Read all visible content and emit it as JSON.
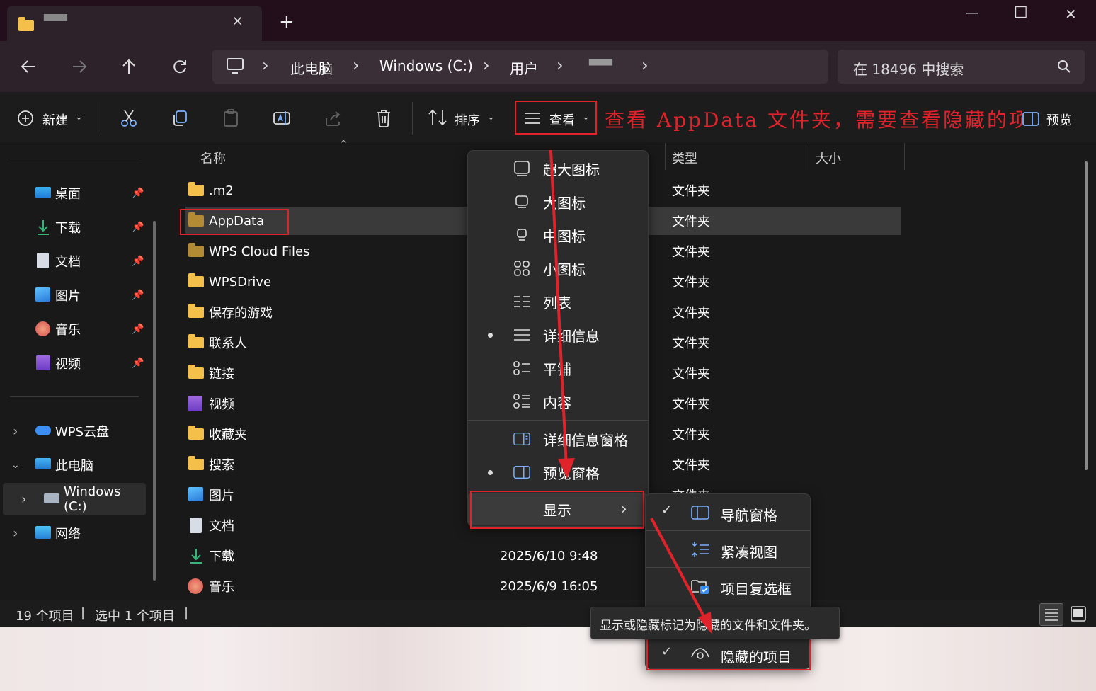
{
  "titlebar": {
    "tab_title": "▀▀▀",
    "close_tab": "✕",
    "new_tab": "+",
    "min": "—",
    "max": "☐",
    "close": "✕"
  },
  "breadcrumb": {
    "items": [
      "此电脑",
      "Windows (C:)",
      "用户",
      "▀▀▀"
    ],
    "chev": "›"
  },
  "search": {
    "placeholder": "在 18496 中搜索"
  },
  "toolbar": {
    "new_label": "新建",
    "sort_label": "排序",
    "view_label": "查看",
    "preview_label": "预览"
  },
  "annotation": {
    "text": "查看 AppData 文件夹，需要查看隐藏的项目"
  },
  "sidebar": {
    "quick": [
      {
        "label": "桌面",
        "icon": "desktop-icon"
      },
      {
        "label": "下载",
        "icon": "download-icon"
      },
      {
        "label": "文档",
        "icon": "document-icon"
      },
      {
        "label": "图片",
        "icon": "picture-icon"
      },
      {
        "label": "音乐",
        "icon": "music-icon"
      },
      {
        "label": "视频",
        "icon": "video-icon"
      }
    ],
    "tree": [
      {
        "label": "WPS云盘",
        "icon": "cloud-icon"
      },
      {
        "label": "此电脑",
        "icon": "computer-icon"
      },
      {
        "label": "Windows (C:)",
        "icon": "drive-icon"
      },
      {
        "label": "网络",
        "icon": "network-icon"
      }
    ]
  },
  "columns": {
    "name": "名称",
    "type": "类型",
    "size": "大小"
  },
  "files": [
    {
      "name": ".m2",
      "type": "文件夹",
      "date": ""
    },
    {
      "name": "AppData",
      "type": "文件夹",
      "date": ""
    },
    {
      "name": "WPS Cloud Files",
      "type": "文件夹",
      "date": ""
    },
    {
      "name": "WPSDrive",
      "type": "文件夹",
      "date": ""
    },
    {
      "name": "保存的游戏",
      "type": "文件夹",
      "date": ""
    },
    {
      "name": "联系人",
      "type": "文件夹",
      "date": ""
    },
    {
      "name": "链接",
      "type": "文件夹",
      "date": ""
    },
    {
      "name": "视频",
      "type": "文件夹",
      "date": ""
    },
    {
      "name": "收藏夹",
      "type": "文件夹",
      "date": ""
    },
    {
      "name": "搜索",
      "type": "文件夹",
      "date": ""
    },
    {
      "name": "图片",
      "type": "文件夹",
      "date": ""
    },
    {
      "name": "文档",
      "type": "",
      "date": ""
    },
    {
      "name": "下载",
      "type": "",
      "date": "2025/6/10 9:48"
    },
    {
      "name": "音乐",
      "type": "",
      "date": "2025/6/9 16:05"
    }
  ],
  "view_menu": {
    "items": [
      {
        "label": "超大图标",
        "icon": "extra-large-icons-icon",
        "selected": false
      },
      {
        "label": "大图标",
        "icon": "large-icons-icon",
        "selected": false
      },
      {
        "label": "中图标",
        "icon": "medium-icons-icon",
        "selected": false
      },
      {
        "label": "小图标",
        "icon": "small-icons-icon",
        "selected": false
      },
      {
        "label": "列表",
        "icon": "list-icon",
        "selected": false
      },
      {
        "label": "详细信息",
        "icon": "details-icon",
        "selected": true
      },
      {
        "label": "平铺",
        "icon": "tiles-icon",
        "selected": false
      },
      {
        "label": "内容",
        "icon": "content-icon",
        "selected": false
      }
    ],
    "panes": [
      {
        "label": "详细信息窗格",
        "icon": "details-pane-icon",
        "selected": false
      },
      {
        "label": "预览窗格",
        "icon": "preview-pane-icon",
        "selected": true
      }
    ],
    "show_label": "显示"
  },
  "show_menu": {
    "items": [
      {
        "label": "导航窗格",
        "checked": true,
        "icon": "navigation-pane-icon"
      },
      {
        "label": "紧凑视图",
        "checked": false,
        "icon": "compact-view-icon"
      },
      {
        "label": "项目复选框",
        "checked": false,
        "icon": "item-checkbox-icon"
      },
      {
        "label": "隐藏的项目",
        "checked": true,
        "icon": "hidden-items-icon"
      }
    ]
  },
  "tooltip": {
    "text": "显示或隐藏标记为隐藏的文件和文件夹。"
  },
  "statusbar": {
    "count": "19 个项目",
    "selected": "选中 1 个项目",
    "sep": "|"
  },
  "colors": {
    "accent_red": "#e0232a",
    "folder_yellow": "#f4c04a"
  }
}
